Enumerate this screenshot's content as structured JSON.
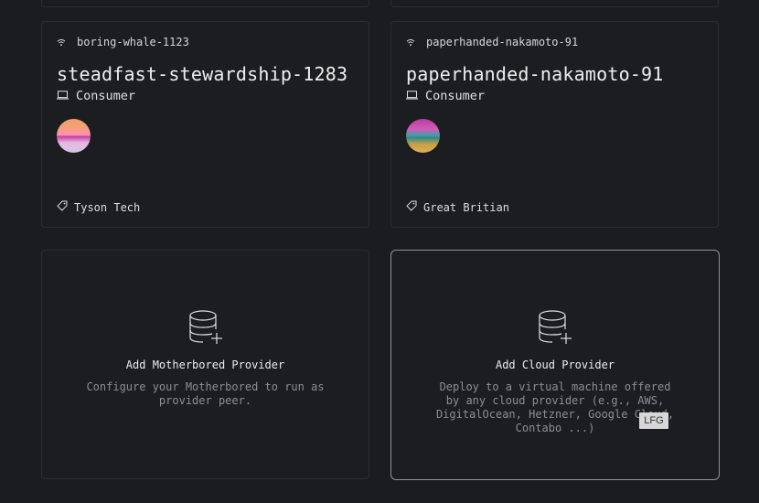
{
  "cards": [
    {
      "peer_name": "boring-whale-1123",
      "title": "steadfast-stewardship-1283",
      "role": "Consumer",
      "tag": "Tyson Tech"
    },
    {
      "peer_name": "paperhanded-nakamoto-91",
      "title": "paperhanded-nakamoto-91",
      "role": "Consumer",
      "tag": "Great Britian"
    }
  ],
  "add_providers": [
    {
      "title": "Add Motherbored Provider",
      "description": "Configure your Motherbored to run as provider peer."
    },
    {
      "title": "Add Cloud Provider",
      "description": "Deploy to a virtual machine offered by any cloud provider (e.g., AWS, DigitalOcean, Hetzner, Google Cloud, Contabo ...)"
    }
  ],
  "tooltip": {
    "label": "LFG"
  },
  "icons": {
    "peer": "wifi-icon",
    "role": "laptop-icon",
    "tag": "tag-icon",
    "add": "database-plus-icon"
  }
}
